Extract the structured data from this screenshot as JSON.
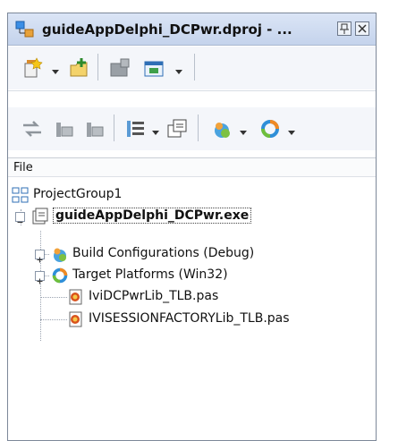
{
  "panel": {
    "title": "guideAppDelphi_DCPwr.dproj - ...",
    "icons": {
      "app": "project-manager-icon",
      "pin": "pin-icon",
      "close": "close-icon"
    }
  },
  "toolbar1": {
    "buttons": [
      "new-item-icon",
      "add-icon",
      "remove-icon",
      "view-icon"
    ]
  },
  "toolbar2": {
    "buttons": [
      "sync-icon",
      "expand-icon",
      "collapse-icon",
      "build-order-icon",
      "build-icon",
      "configuration-icon",
      "platform-icon"
    ]
  },
  "tree": {
    "header": "File",
    "items": [
      {
        "label": "ProjectGroup1",
        "icon": "project-group-icon"
      },
      {
        "label": "guideAppDelphi_DCPwr.exe",
        "icon": "exe-project-icon",
        "bold": true
      },
      {
        "label": "Build Configurations (Debug)",
        "icon": "build-config-icon"
      },
      {
        "label": "Target Platforms (Win32)",
        "icon": "target-platform-icon"
      },
      {
        "label": "IviDCPwrLib_TLB.pas",
        "icon": "pas-file-icon"
      },
      {
        "label": "IVISESSIONFACTORYLib_TLB.pas",
        "icon": "pas-file-icon"
      }
    ]
  }
}
